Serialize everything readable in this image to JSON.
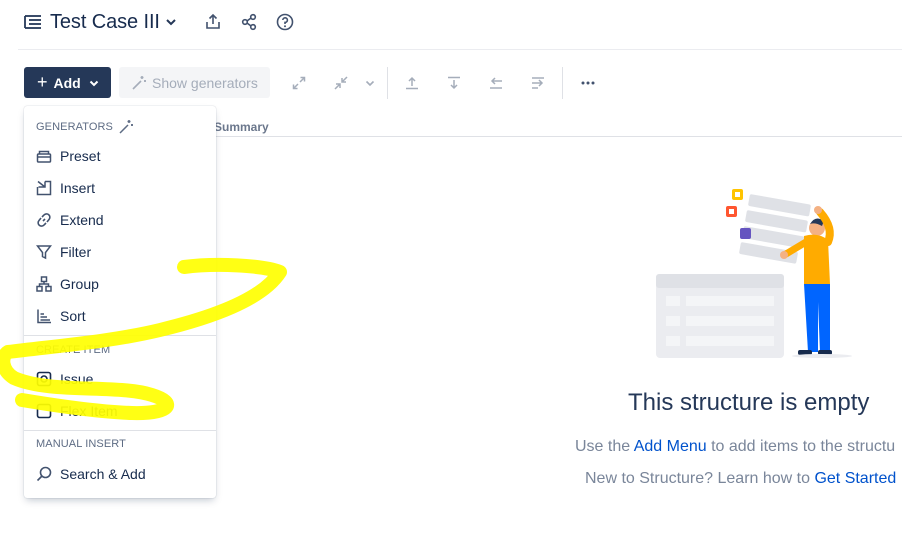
{
  "header": {
    "title": "Test Case III",
    "icons": [
      "structure-doc-icon",
      "chevron-down-icon",
      "export-icon",
      "share-icon",
      "help-icon"
    ]
  },
  "toolbar": {
    "add_label": "Add",
    "show_generators_label": "Show generators",
    "icons": [
      "expand-icon",
      "collapse-icon",
      "chevron-down-icon",
      "move-up-icon",
      "move-down-icon",
      "move-left-icon",
      "move-right-icon",
      "more-icon"
    ]
  },
  "table": {
    "summary_header": "Summary"
  },
  "menu": {
    "generators_title": "GENERATORS",
    "generators": [
      {
        "label": "Preset",
        "icon": "preset-icon"
      },
      {
        "label": "Insert",
        "icon": "insert-icon"
      },
      {
        "label": "Extend",
        "icon": "link-icon"
      },
      {
        "label": "Filter",
        "icon": "filter-icon"
      },
      {
        "label": "Group",
        "icon": "group-icon"
      },
      {
        "label": "Sort",
        "icon": "sort-icon"
      }
    ],
    "create_title": "CREATE ITEM",
    "create": [
      {
        "label": "Issue",
        "icon": "issue-icon"
      },
      {
        "label": "Flex Item",
        "icon": "flex-item-icon"
      }
    ],
    "manual_title": "MANUAL INSERT",
    "manual": [
      {
        "label": "Search & Add",
        "icon": "search-icon"
      }
    ]
  },
  "empty_state": {
    "title": "This structure is empty",
    "line1_prefix": "Use the ",
    "line1_link": "Add Menu",
    "line1_suffix": " to add items to the structu",
    "line2_prefix": "New to Structure? Learn how to ",
    "line2_link": "Get Started"
  },
  "colors": {
    "primary_button": "#253858",
    "link": "#0052cc",
    "highlighter": "#ffff00"
  }
}
